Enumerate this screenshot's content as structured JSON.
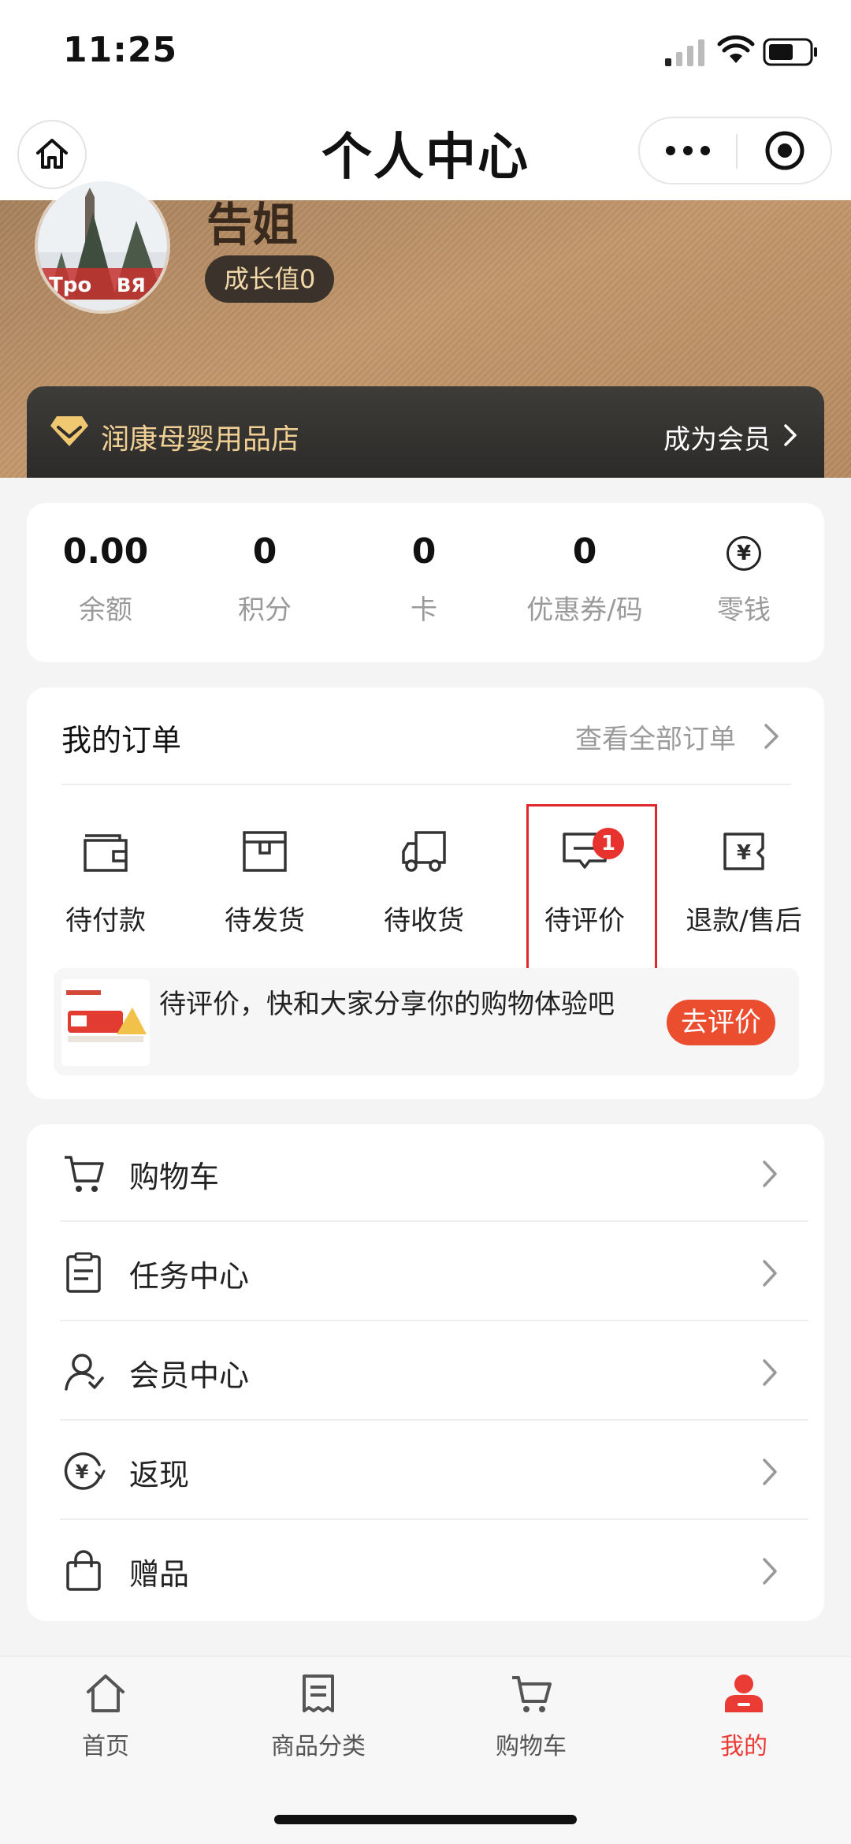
{
  "status_bar": {
    "time": "11:25"
  },
  "nav": {
    "title": "个人中心"
  },
  "profile": {
    "name": "告姐",
    "growth": "成长值0"
  },
  "member_bar": {
    "store_name": "润康母婴用品店",
    "cta": "成为会员"
  },
  "assets": [
    {
      "value": "0.00",
      "label": "余额"
    },
    {
      "value": "0",
      "label": "积分"
    },
    {
      "value": "0",
      "label": "卡"
    },
    {
      "value": "0",
      "label": "优惠券/码"
    },
    {
      "value": "¥",
      "label": "零钱"
    }
  ],
  "orders": {
    "title": "我的订单",
    "view_all": "查看全部订单",
    "items": [
      {
        "label": "待付款",
        "icon": "wallet-icon"
      },
      {
        "label": "待发货",
        "icon": "box-icon"
      },
      {
        "label": "待收货",
        "icon": "truck-icon"
      },
      {
        "label": "待评价",
        "icon": "comment-icon",
        "badge": "1"
      },
      {
        "label": "退款/售后",
        "icon": "refund-icon"
      }
    ],
    "review_prompt": "待评价，快和大家分享你的购物体验吧",
    "review_button": "去评价"
  },
  "menu": [
    {
      "label": "购物车",
      "icon": "cart-icon"
    },
    {
      "label": "任务中心",
      "icon": "clipboard-icon"
    },
    {
      "label": "会员中心",
      "icon": "member-icon"
    },
    {
      "label": "返现",
      "icon": "cashback-icon"
    },
    {
      "label": "赠品",
      "icon": "gift-bag-icon"
    }
  ],
  "tabs": [
    {
      "label": "首页",
      "icon": "home-icon"
    },
    {
      "label": "商品分类",
      "icon": "category-icon"
    },
    {
      "label": "购物车",
      "icon": "cart-icon"
    },
    {
      "label": "我的",
      "icon": "user-icon",
      "active": true
    }
  ],
  "colors": {
    "accent": "#ea3b35",
    "badge": "#e8322e",
    "review_button": "#eb4d2f",
    "gold": "#f0cf94",
    "banner": "#c2976b"
  }
}
